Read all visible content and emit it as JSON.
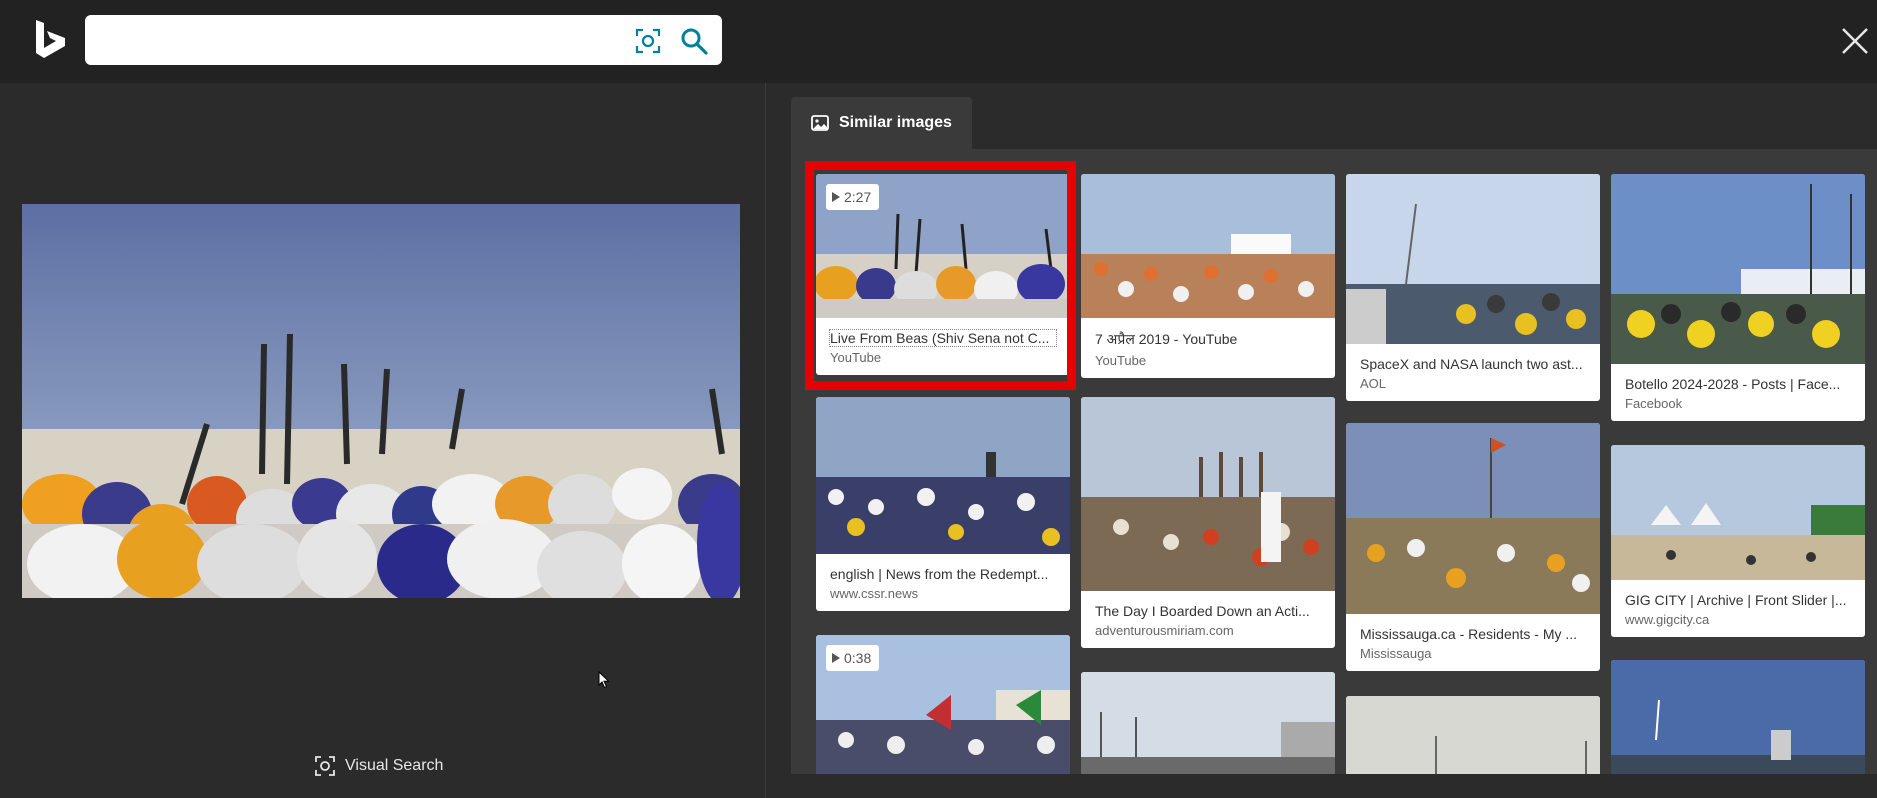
{
  "header": {
    "logo_icon": "bing-logo-icon",
    "search": {
      "value": "",
      "placeholder": ""
    },
    "visual_search_icon": "camera-lens-icon",
    "search_icon": "magnifier-icon",
    "close_icon": "close-x-icon"
  },
  "preview": {
    "visual_search_label": "Visual Search"
  },
  "tabs": {
    "similar_images_label": "Similar images",
    "similar_images_icon": "image-icon"
  },
  "results": [
    {
      "title": "Live From Beas (Shiv Sena not C...",
      "source": "YouTube",
      "badge": "2:27",
      "selected": true
    },
    {
      "title": "7 अप्रैल 2019 - YouTube",
      "source": "YouTube"
    },
    {
      "title": "SpaceX and NASA launch two ast...",
      "source": "AOL"
    },
    {
      "title": "Botello 2024-2028 - Posts | Face...",
      "source": "Facebook"
    },
    {
      "title": "english | News from the Redempt...",
      "source": "www.cssr.news"
    },
    {
      "title": "The Day I Boarded Down an Acti...",
      "source": "adventurousmiriam.com"
    },
    {
      "title": "Mississauga.ca - Residents - My ...",
      "source": "Mississauga"
    },
    {
      "title": "GIG CITY | Archive | Front Slider |...",
      "source": "www.gigcity.ca"
    },
    {
      "badge": "0:38"
    }
  ],
  "colors": {
    "header_bg": "#222222",
    "panel_bg": "#2b2b2b",
    "results_bg": "#3a3a3a",
    "selection": "#e60000",
    "accent": "#00809d"
  }
}
